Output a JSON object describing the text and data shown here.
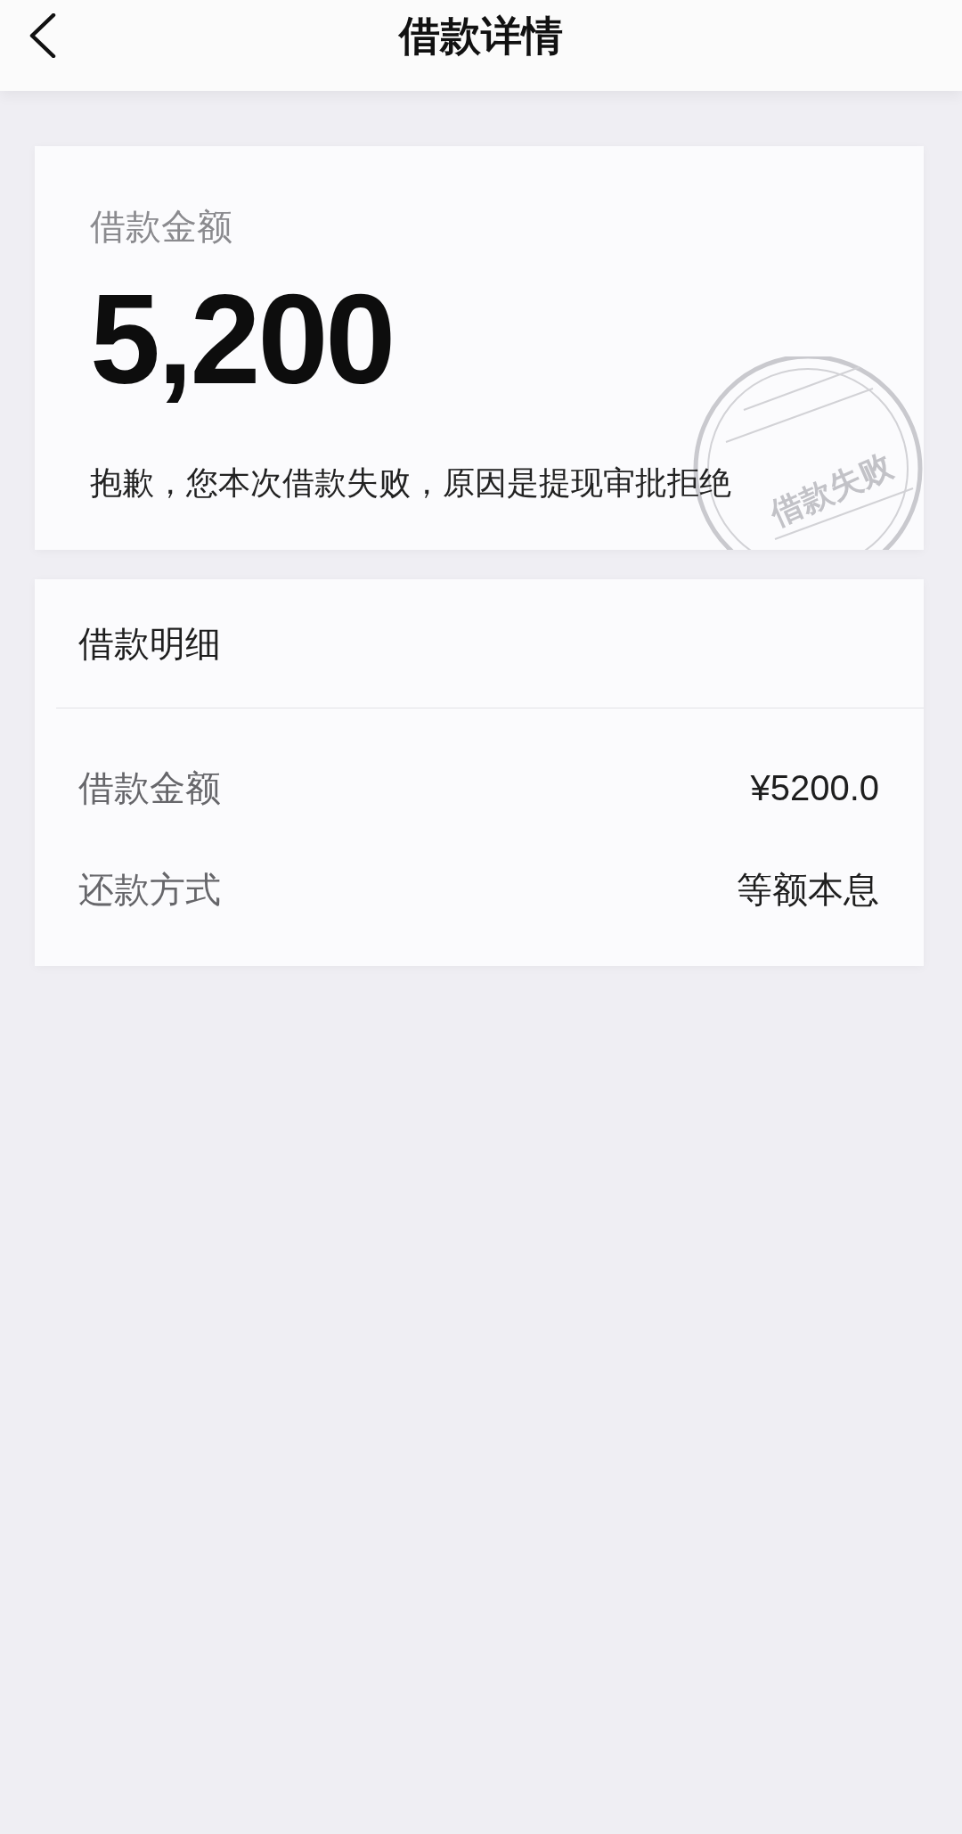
{
  "header": {
    "title": "借款详情"
  },
  "summary": {
    "label": "借款金额",
    "amount": "5,200",
    "message": "抱歉，您本次借款失败，原因是提现审批拒绝",
    "stamp": "借款失败"
  },
  "details": {
    "title": "借款明细",
    "rows": [
      {
        "label": "借款金额",
        "value": "¥5200.0"
      },
      {
        "label": "还款方式",
        "value": "等额本息"
      }
    ]
  }
}
